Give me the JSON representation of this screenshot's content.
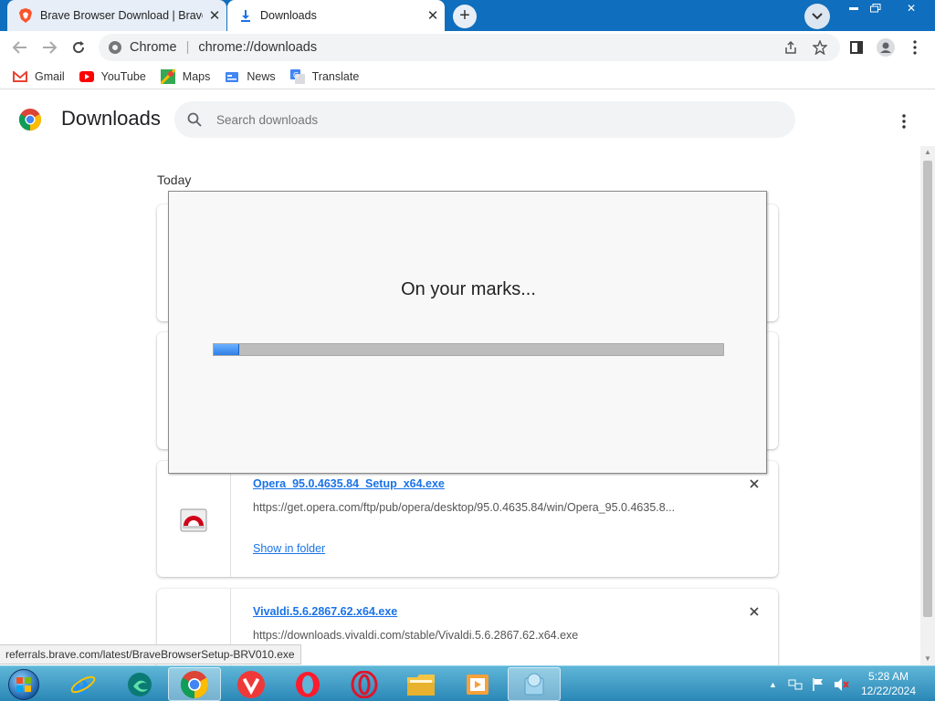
{
  "tabs": [
    {
      "title": "Brave Browser Download | Brave",
      "icon": "brave-icon",
      "active": false
    },
    {
      "title": "Downloads",
      "icon": "download-icon",
      "active": true
    }
  ],
  "toolbar": {
    "site_label": "Chrome",
    "url": "chrome://downloads"
  },
  "bookmarks": [
    {
      "label": "Gmail",
      "icon": "gmail-icon"
    },
    {
      "label": "YouTube",
      "icon": "youtube-icon"
    },
    {
      "label": "Maps",
      "icon": "maps-icon"
    },
    {
      "label": "News",
      "icon": "news-icon"
    },
    {
      "label": "Translate",
      "icon": "translate-icon"
    }
  ],
  "downloads_page": {
    "title": "Downloads",
    "search_placeholder": "Search downloads",
    "section": "Today",
    "items": [
      {
        "filename": "Opera_95.0.4635.84_Setup_x64.exe",
        "url": "https://get.opera.com/ftp/pub/opera/desktop/95.0.4635.84/win/Opera_95.0.4635.8...",
        "action": "Show in folder",
        "icon": "opera-installer-icon"
      },
      {
        "filename": "Vivaldi.5.6.2867.62.x64.exe",
        "url": "https://downloads.vivaldi.com/stable/Vivaldi.5.6.2867.62.x64.exe",
        "icon": "vivaldi-icon"
      }
    ]
  },
  "installer": {
    "message": "On your marks...",
    "progress_fraction": 0.05
  },
  "status_bubble": "referrals.brave.com/latest/BraveBrowserSetup-BRV010.exe",
  "taskbar": {
    "apps": [
      "internet-explorer-icon",
      "edge-icon",
      "chrome-icon",
      "vivaldi-icon",
      "opera-icon",
      "opera-gx-icon",
      "file-explorer-icon",
      "media-player-icon",
      "installer-icon"
    ],
    "time": "5:28 AM",
    "date": "12/22/2024"
  },
  "colors": {
    "titlebar": "#0f6ebd",
    "link": "#1a73e8",
    "progress": "#2f7fe6"
  }
}
